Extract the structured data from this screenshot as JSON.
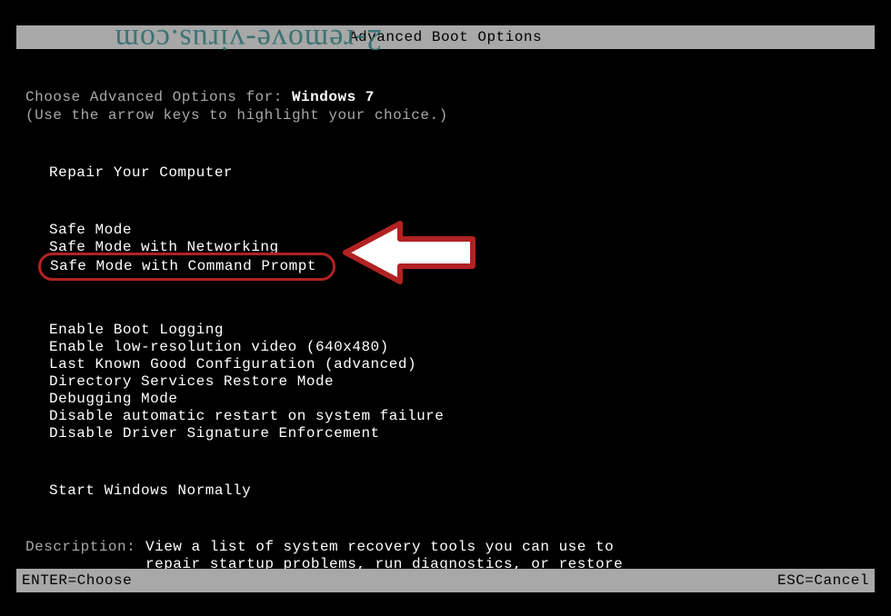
{
  "watermark": "2-remove-virus.com",
  "title": "Advanced Boot Options",
  "choose_label_pre": "Choose Advanced Options for: ",
  "os_name": "Windows 7",
  "hint": "(Use the arrow keys to highlight your choice.)",
  "groups": [
    {
      "items": [
        "Repair Your Computer"
      ]
    },
    {
      "items": [
        "Safe Mode",
        "Safe Mode with Networking",
        "Safe Mode with Command Prompt"
      ],
      "highlighted_index": 2
    },
    {
      "items": [
        "Enable Boot Logging",
        "Enable low-resolution video (640x480)",
        "Last Known Good Configuration (advanced)",
        "Directory Services Restore Mode",
        "Debugging Mode",
        "Disable automatic restart on system failure",
        "Disable Driver Signature Enforcement"
      ]
    },
    {
      "items": [
        "Start Windows Normally"
      ]
    }
  ],
  "description_label": "Description:",
  "description_text": "View a list of system recovery tools you can use to repair startup problems, run diagnostics, or restore your system.",
  "footer_left": "ENTER=Choose",
  "footer_right": "ESC=Cancel"
}
